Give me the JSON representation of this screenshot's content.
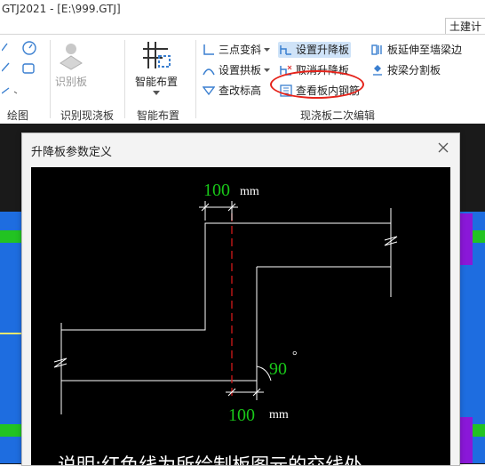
{
  "titlebar": {
    "title": "GTJ2021 - [E:\\999.GTJ]",
    "tab_right": "土建计"
  },
  "ribbon": {
    "groups": [
      {
        "label": "绘图"
      },
      {
        "label": "识别现浇板",
        "button": "识别板"
      },
      {
        "label": "智能布置",
        "button": "智能布置"
      },
      {
        "label": "现浇板二次编辑",
        "items": [
          "三点变斜",
          "设置升降板",
          "板延伸至墙梁边",
          "设置拱板",
          "取消升降板",
          "按梁分割板",
          "查改标高",
          "查看板内钢筋"
        ]
      }
    ]
  },
  "dialog": {
    "title": "升降板参数定义",
    "diagram": {
      "dim_top_value": "100",
      "dim_top_unit": "mm",
      "angle_value": "90",
      "angle_unit": "°",
      "dim_bottom_value": "100",
      "dim_bottom_unit": "mm",
      "note": "说明:红色线为所绘制板图元的交线处"
    }
  },
  "colors": {
    "accent_green": "#19c719",
    "red_line": "#d11a1a",
    "workspace_blue": "#1e6de0",
    "workspace_green": "#22c322",
    "workspace_purple": "#8a18d8"
  }
}
